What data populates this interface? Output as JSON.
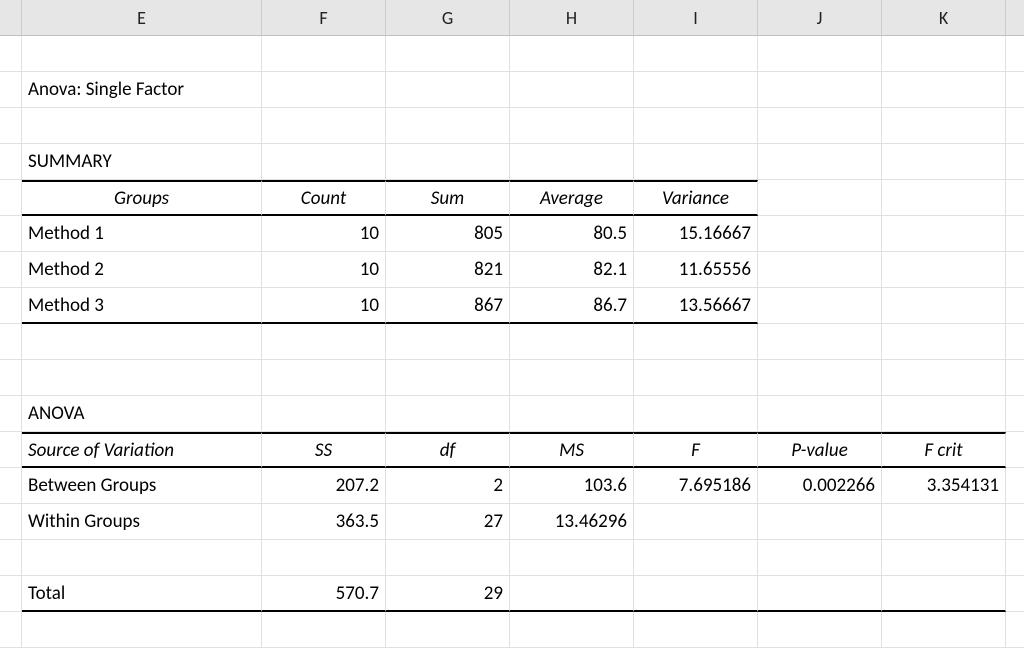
{
  "columns": [
    "E",
    "F",
    "G",
    "H",
    "I",
    "J",
    "K"
  ],
  "title": "Anova: Single Factor",
  "summary": {
    "heading": "SUMMARY",
    "cols": [
      "Groups",
      "Count",
      "Sum",
      "Average",
      "Variance"
    ],
    "rows": [
      {
        "group": "Method 1",
        "count": "10",
        "sum": "805",
        "avg": "80.5",
        "var": "15.16667"
      },
      {
        "group": "Method 2",
        "count": "10",
        "sum": "821",
        "avg": "82.1",
        "var": "11.65556"
      },
      {
        "group": "Method 3",
        "count": "10",
        "sum": "867",
        "avg": "86.7",
        "var": "13.56667"
      }
    ]
  },
  "anova": {
    "heading": "ANOVA",
    "cols": [
      "Source of Variation",
      "SS",
      "df",
      "MS",
      "F",
      "P-value",
      "F crit"
    ],
    "between": {
      "label": "Between Groups",
      "ss": "207.2",
      "df": "2",
      "ms": "103.6",
      "f": "7.695186",
      "p": "0.002266",
      "fcrit": "3.354131"
    },
    "within": {
      "label": "Within Groups",
      "ss": "363.5",
      "df": "27",
      "ms": "13.46296",
      "f": "",
      "p": "",
      "fcrit": ""
    },
    "total": {
      "label": "Total",
      "ss": "570.7",
      "df": "29",
      "ms": "",
      "f": "",
      "p": "",
      "fcrit": ""
    }
  },
  "chart_data": {
    "type": "table",
    "title": "Anova: Single Factor",
    "summary": {
      "columns": [
        "Groups",
        "Count",
        "Sum",
        "Average",
        "Variance"
      ],
      "rows": [
        [
          "Method 1",
          10,
          805,
          80.5,
          15.16667
        ],
        [
          "Method 2",
          10,
          821,
          82.1,
          11.65556
        ],
        [
          "Method 3",
          10,
          867,
          86.7,
          13.56667
        ]
      ]
    },
    "anova": {
      "columns": [
        "Source of Variation",
        "SS",
        "df",
        "MS",
        "F",
        "P-value",
        "F crit"
      ],
      "rows": [
        [
          "Between Groups",
          207.2,
          2,
          103.6,
          7.695186,
          0.002266,
          3.354131
        ],
        [
          "Within Groups",
          363.5,
          27,
          13.46296,
          null,
          null,
          null
        ],
        [
          "Total",
          570.7,
          29,
          null,
          null,
          null,
          null
        ]
      ]
    }
  }
}
